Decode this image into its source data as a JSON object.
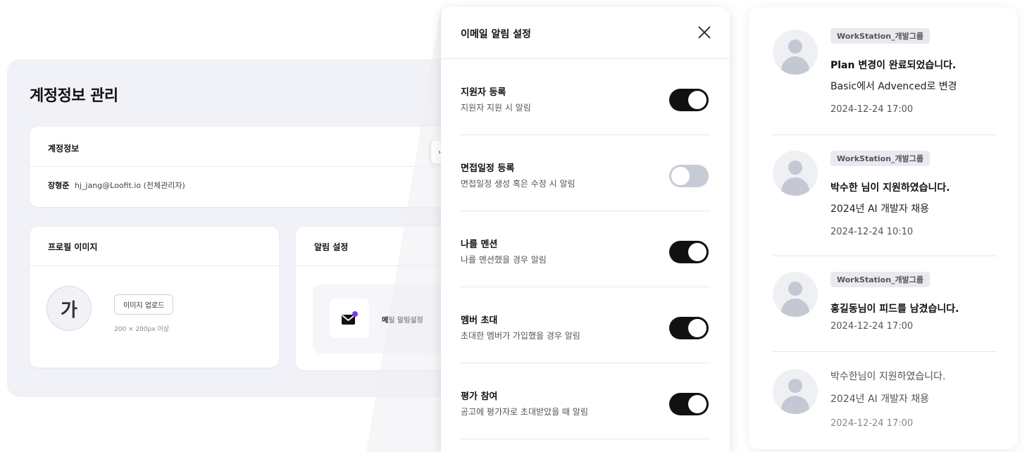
{
  "account_page": {
    "title": "계정정보 관리",
    "account_card": {
      "heading": "계정정보",
      "name": "장형준",
      "email_role": "hj_jang@Loofit.io (전체관리자)"
    },
    "profile_card": {
      "heading": "프로필 이미지",
      "avatar_letter": "가",
      "upload_label": "이미지 업로드",
      "size_hint": "200 × 200px 이상"
    },
    "alarm_card": {
      "heading": "알림 설정",
      "mail_label": "메일 알림설정"
    }
  },
  "email_modal": {
    "title": "이메일 알림 설정",
    "settings": [
      {
        "title": "지원자 등록",
        "description": "지원자 지원 시 알림",
        "enabled": true
      },
      {
        "title": "면접일정 등록",
        "description": "면접일정 생성 혹은 수정 시 알림",
        "enabled": false
      },
      {
        "title": "나를 멘션",
        "description": "나를 멘션했을 경우 알림",
        "enabled": true
      },
      {
        "title": "멤버 초대",
        "description": "초대한 멤버가 가입했을 경우 알림",
        "enabled": true
      },
      {
        "title": "평가 참여",
        "description": "공고에 평가자로 초대받았을 때 알림",
        "enabled": true
      }
    ]
  },
  "feed": {
    "items": [
      {
        "tag": "WorkStation_개발그룹",
        "title": "Plan 변경이 완료되었습니다.",
        "subtitle": "Basic에서 Advenced로 변경",
        "time": "2024-12-24 17:00"
      },
      {
        "tag": "WorkStation_개발그룹",
        "title": "박수한 님이 지원하였습니다.",
        "subtitle": "2024년 AI 개발자 채용",
        "time": "2024-12-24 10:10"
      },
      {
        "tag": "WorkStation_개발그룹",
        "title": "홍길동님이 피드를 남겼습니다.",
        "time": "2024-12-24 17:00"
      },
      {
        "line1": "박수한님이 지원하였습니다.",
        "line2": "2024년 AI 개발자 채용",
        "time": "2024-12-24 17:00"
      }
    ]
  }
}
